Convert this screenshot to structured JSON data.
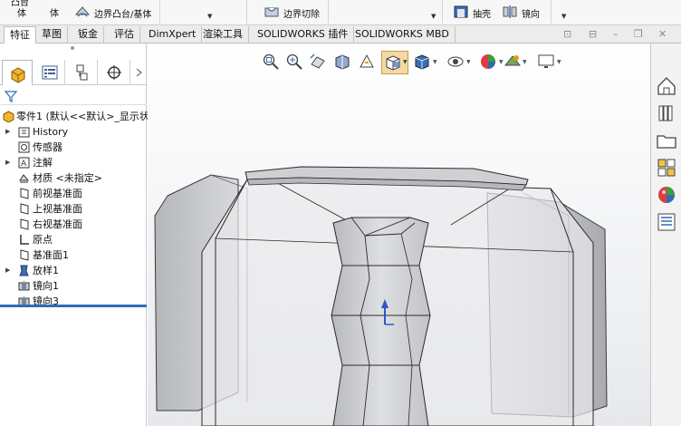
{
  "ribbon": {
    "items": {
      "solid_body_top": "凸台",
      "solid_body": "体",
      "solid_body2": "体",
      "boundary_boss": "边界凸台/基体",
      "boundary_cut": "边界切除",
      "shell": "抽壳",
      "mirror": "镜向"
    }
  },
  "tabs": [
    "特征",
    "草图",
    "钣金",
    "评估",
    "DimXpert",
    "渲染工具",
    "SOLIDWORKS 插件",
    "SOLIDWORKS MBD"
  ],
  "active_tab": "特征",
  "feature_tree": {
    "root": "零件1 (默认<<默认>_显示状",
    "items": [
      {
        "label": "History",
        "icon": "history-folder-icon",
        "expandable": true
      },
      {
        "label": "传感器",
        "icon": "sensor-icon",
        "expandable": false
      },
      {
        "label": "注解",
        "icon": "annotation-icon",
        "expandable": true
      },
      {
        "label": "材质 <未指定>",
        "icon": "material-icon",
        "expandable": false
      },
      {
        "label": "前视基准面",
        "icon": "plane-icon",
        "expandable": false
      },
      {
        "label": "上视基准面",
        "icon": "plane-icon",
        "expandable": false
      },
      {
        "label": "右视基准面",
        "icon": "plane-icon",
        "expandable": false
      },
      {
        "label": "原点",
        "icon": "origin-icon",
        "expandable": false
      },
      {
        "label": "基准面1",
        "icon": "plane-icon",
        "expandable": false
      },
      {
        "label": "放样1",
        "icon": "loft-icon",
        "expandable": true
      },
      {
        "label": "镜向1",
        "icon": "mirror-icon",
        "expandable": false
      },
      {
        "label": "镜向3",
        "icon": "mirror-icon",
        "expandable": false
      }
    ]
  },
  "colors": {
    "accent": "#2f6db0",
    "model_face": "#c8c9cc",
    "model_edge": "#2a2a2a"
  }
}
